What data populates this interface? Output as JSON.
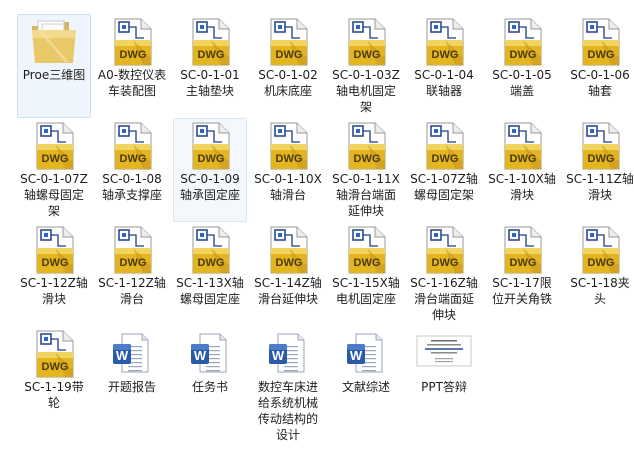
{
  "colors": {
    "selection_bg": "#eef5fd",
    "selection_border": "#c9dff6",
    "dwg_gold": "#e3b520",
    "dwg_text": "#4a3a10",
    "word_blue": "#2b5aa8",
    "folder_yellow": "#e9c86a"
  },
  "items": [
    {
      "label": "Proe三维图",
      "icon": "folder-icon",
      "state": "selected"
    },
    {
      "label": "A0-数控仪表车装配图",
      "icon": "dwg-file-icon"
    },
    {
      "label": "SC-0-1-01主轴垫块",
      "icon": "dwg-file-icon"
    },
    {
      "label": "SC-0-1-02机床底座",
      "icon": "dwg-file-icon"
    },
    {
      "label": "SC-0-1-03Z轴电机固定架",
      "icon": "dwg-file-icon"
    },
    {
      "label": "SC-0-1-04联轴器",
      "icon": "dwg-file-icon"
    },
    {
      "label": "SC-0-1-05端盖",
      "icon": "dwg-file-icon"
    },
    {
      "label": "SC-0-1-06轴套",
      "icon": "dwg-file-icon"
    },
    {
      "label": "SC-0-1-07Z轴螺母固定架",
      "icon": "dwg-file-icon"
    },
    {
      "label": "SC-0-1-08轴承支撑座",
      "icon": "dwg-file-icon"
    },
    {
      "label": "SC-0-1-09轴承固定座",
      "icon": "dwg-file-icon",
      "state": "hover"
    },
    {
      "label": "SC-0-1-10X轴滑台",
      "icon": "dwg-file-icon"
    },
    {
      "label": "SC-0-1-11X轴滑台端面延伸块",
      "icon": "dwg-file-icon"
    },
    {
      "label": "SC-1-07Z轴螺母固定架",
      "icon": "dwg-file-icon"
    },
    {
      "label": "SC-1-10X轴滑块",
      "icon": "dwg-file-icon"
    },
    {
      "label": "SC-1-11Z轴滑块",
      "icon": "dwg-file-icon"
    },
    {
      "label": "SC-1-12Z轴滑块",
      "icon": "dwg-file-icon"
    },
    {
      "label": "SC-1-12Z轴滑台",
      "icon": "dwg-file-icon"
    },
    {
      "label": "SC-1-13X轴螺母固定座",
      "icon": "dwg-file-icon"
    },
    {
      "label": "SC-1-14Z轴滑台延伸块",
      "icon": "dwg-file-icon"
    },
    {
      "label": "SC-1-15X轴电机固定座",
      "icon": "dwg-file-icon"
    },
    {
      "label": "SC-1-16Z轴滑台端面延伸块",
      "icon": "dwg-file-icon"
    },
    {
      "label": "SC-1-17限位开关角铁",
      "icon": "dwg-file-icon"
    },
    {
      "label": "SC-1-18夹头",
      "icon": "dwg-file-icon"
    },
    {
      "label": "SC-1-19带轮",
      "icon": "dwg-file-icon"
    },
    {
      "label": "开题报告",
      "icon": "word-doc-icon"
    },
    {
      "label": "任务书",
      "icon": "word-doc-icon"
    },
    {
      "label": "数控车床进给系统机械传动结构的设计",
      "icon": "word-doc-icon"
    },
    {
      "label": "文献综述",
      "icon": "word-doc-icon"
    },
    {
      "label": "PPT答辩",
      "icon": "ppt-thumbnail-icon"
    }
  ]
}
